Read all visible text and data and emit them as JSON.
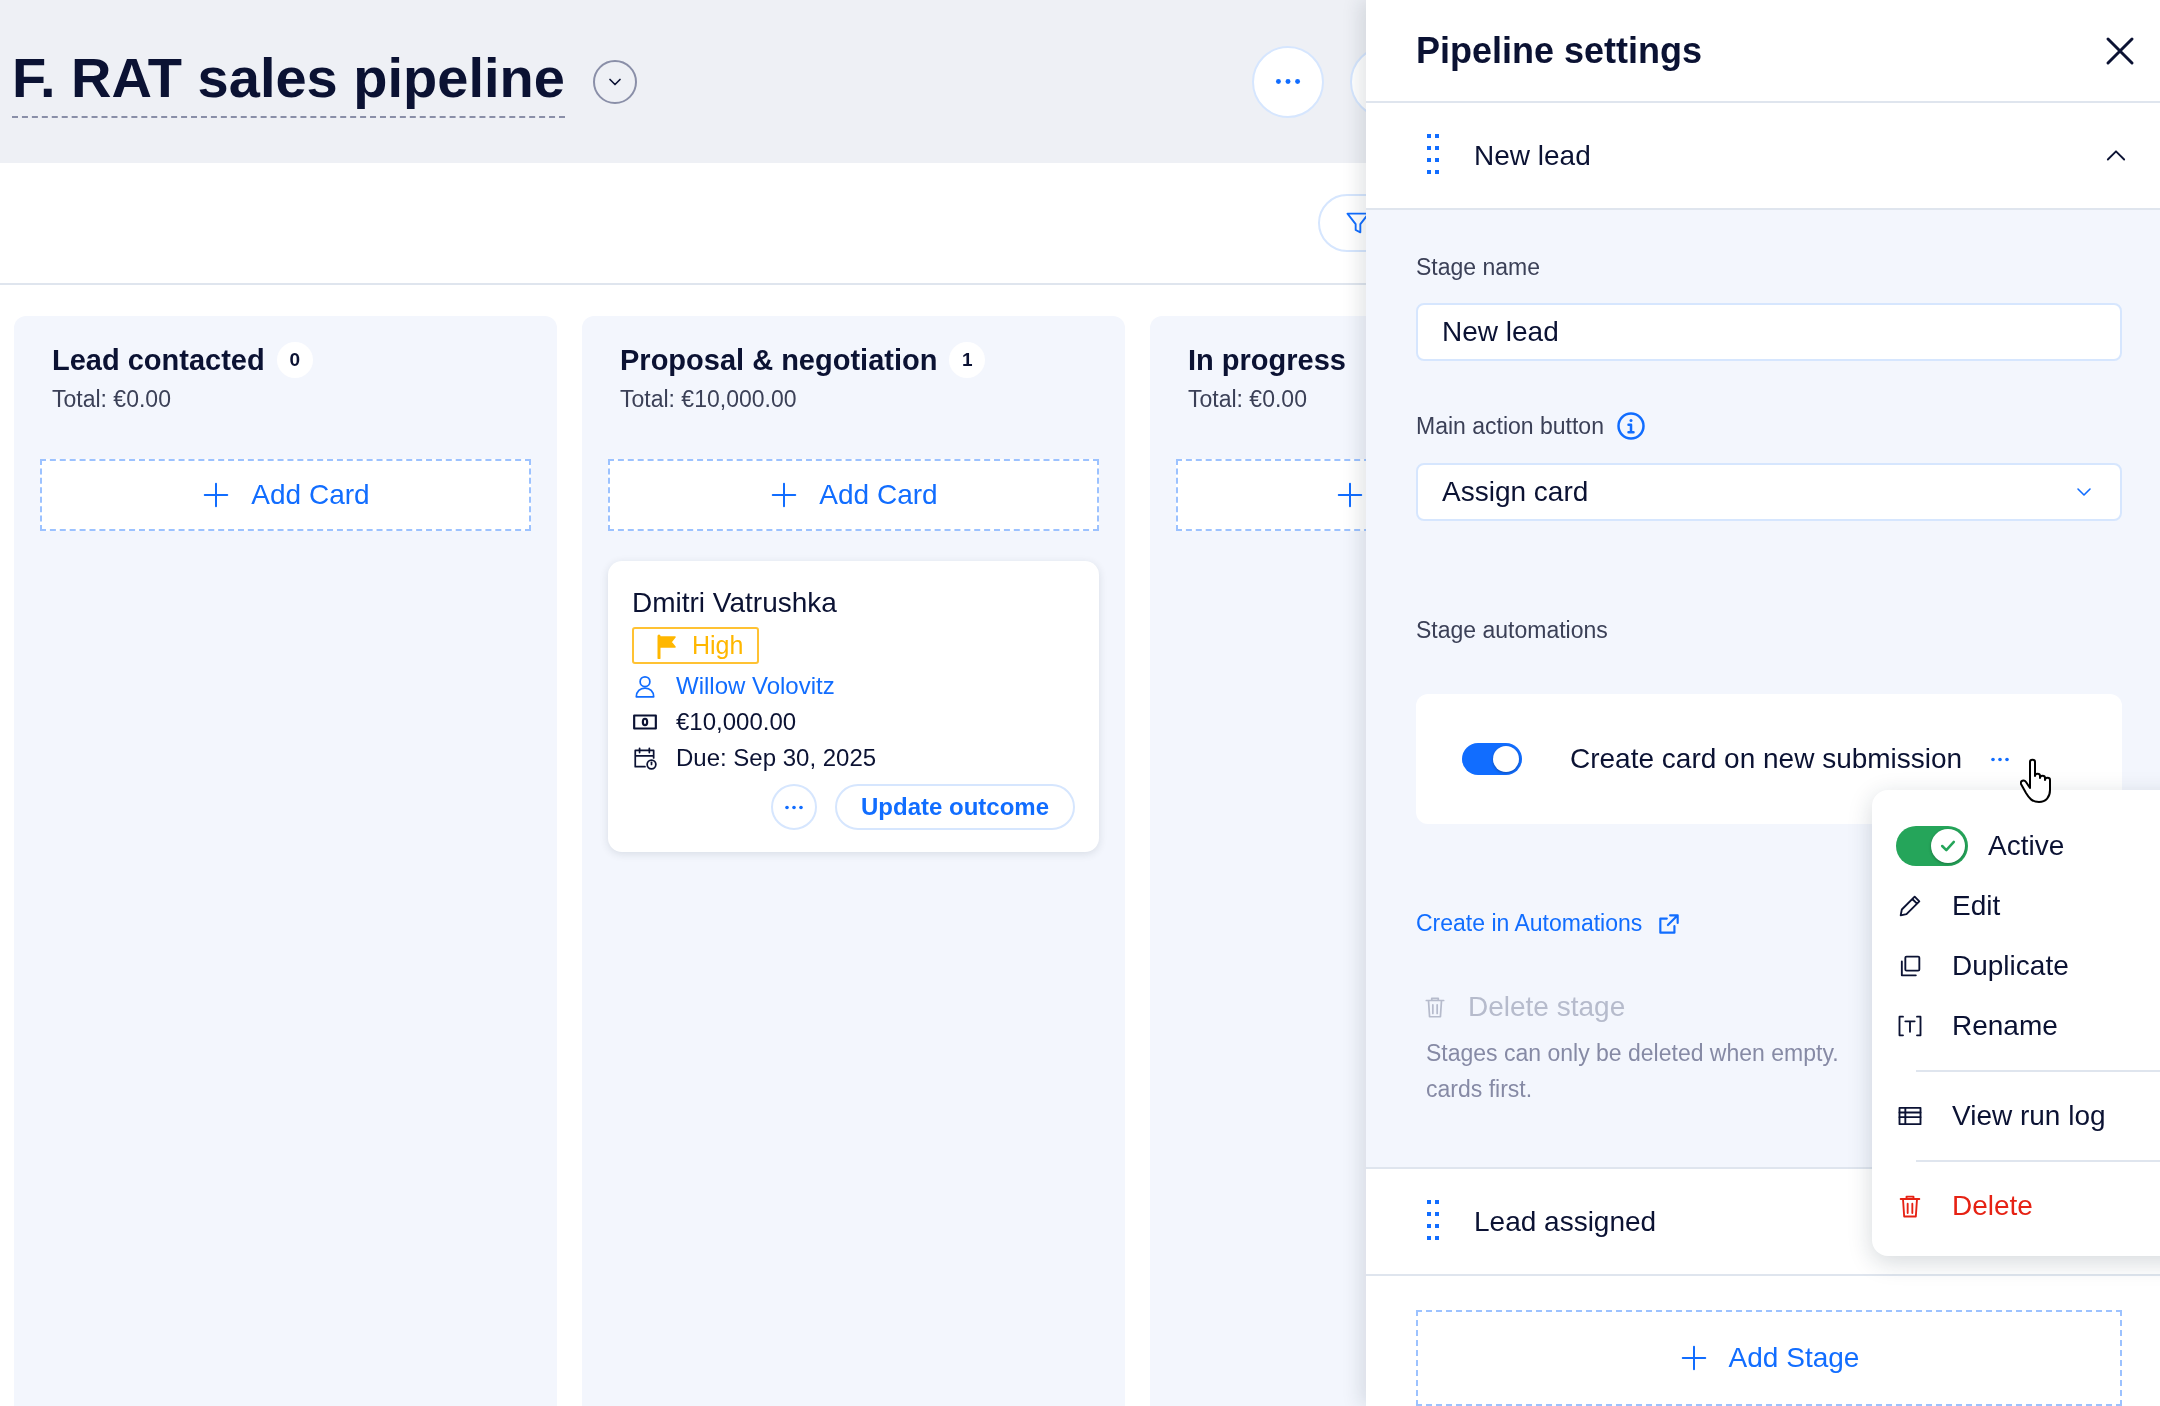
{
  "page": {
    "title": "F. RAT sales pipeline"
  },
  "stages": [
    {
      "name": "Lead contacted",
      "count": "0",
      "total": "Total: €0.00",
      "add_label": "Add Card"
    },
    {
      "name": "Proposal & negotiation",
      "count": "1",
      "total": "Total: €10,000.00",
      "add_label": "Add Card",
      "cards": [
        {
          "name": "Dmitri Vatrushka",
          "priority": "High",
          "assignee": "Willow Volovitz",
          "amount": "€10,000.00",
          "due": "Due: Sep 30, 2025",
          "action": "Update outcome"
        }
      ]
    },
    {
      "name": "In progress",
      "total": "Total: €0.00"
    }
  ],
  "panel": {
    "title": "Pipeline settings",
    "add_stage": "Add Stage",
    "sections": [
      {
        "name": "New lead",
        "expanded": true,
        "stage_name_label": "Stage name",
        "stage_name_value": "New lead",
        "main_action_label": "Main action button",
        "main_action_value": "Assign card",
        "automations_label": "Stage automations",
        "automations": [
          {
            "name": "Create card on new submission",
            "on": true
          }
        ],
        "create_link": "Create in Automations",
        "delete_stage": {
          "label": "Delete stage",
          "disabled": true,
          "note_lines": [
            "Stages can only be deleted when empty.",
            "cards first."
          ]
        }
      },
      {
        "name": "Lead assigned",
        "expanded": false
      }
    ]
  },
  "menu": {
    "items": [
      {
        "kind": "toggle",
        "label": "Active",
        "on": true,
        "divider_above": false
      },
      {
        "kind": "edit",
        "label": "Edit",
        "divider_above": false
      },
      {
        "kind": "duplicate",
        "label": "Duplicate",
        "divider_above": false
      },
      {
        "kind": "rename",
        "label": "Rename",
        "divider_above": false
      },
      {
        "kind": "log",
        "label": "View run log",
        "divider_above": true
      },
      {
        "kind": "delete",
        "label": "Delete",
        "divider_above": true
      }
    ]
  }
}
